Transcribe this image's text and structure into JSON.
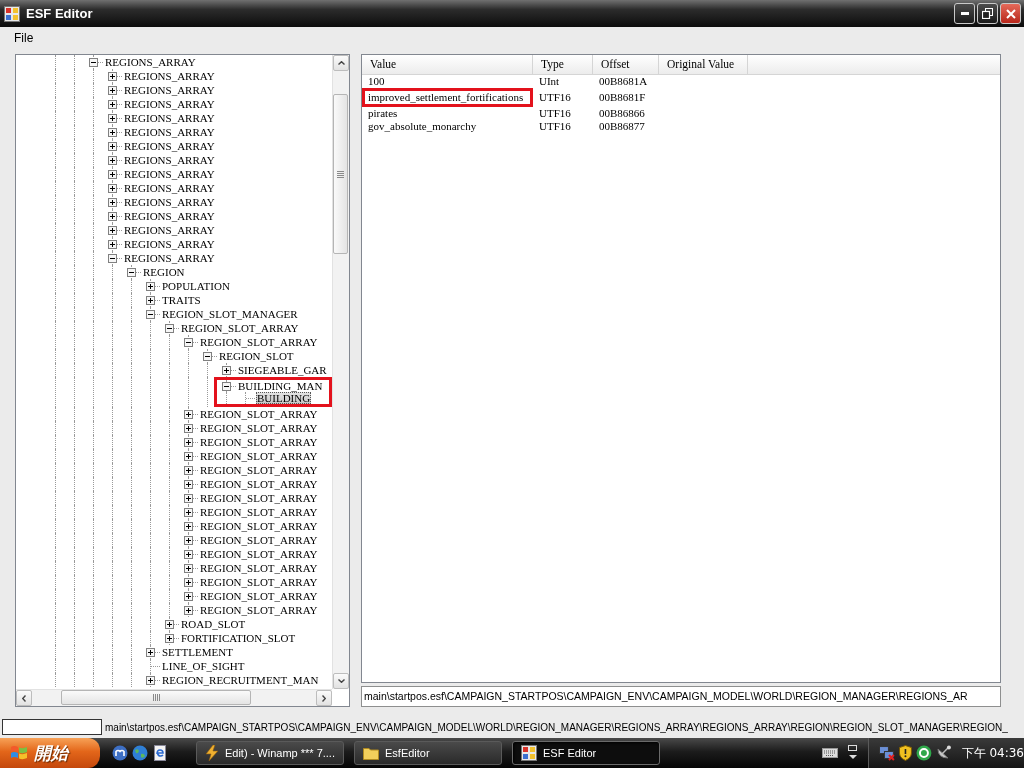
{
  "window": {
    "title": "ESF Editor"
  },
  "menu": [
    "File"
  ],
  "tree": {
    "nodes": [
      {
        "label": "REGIONS_ARRAY",
        "kind": "branch",
        "expanded": true,
        "selected": false,
        "highlighted": false,
        "children": [
          {
            "label": "REGIONS_ARRAY",
            "kind": "branch",
            "expanded": false,
            "selected": false,
            "highlighted": false
          },
          {
            "label": "REGIONS_ARRAY",
            "kind": "branch",
            "expanded": false,
            "selected": false,
            "highlighted": false
          },
          {
            "label": "REGIONS_ARRAY",
            "kind": "branch",
            "expanded": false,
            "selected": false,
            "highlighted": false
          },
          {
            "label": "REGIONS_ARRAY",
            "kind": "branch",
            "expanded": false,
            "selected": false,
            "highlighted": false
          },
          {
            "label": "REGIONS_ARRAY",
            "kind": "branch",
            "expanded": false,
            "selected": false,
            "highlighted": false
          },
          {
            "label": "REGIONS_ARRAY",
            "kind": "branch",
            "expanded": false,
            "selected": false,
            "highlighted": false
          },
          {
            "label": "REGIONS_ARRAY",
            "kind": "branch",
            "expanded": false,
            "selected": false,
            "highlighted": false
          },
          {
            "label": "REGIONS_ARRAY",
            "kind": "branch",
            "expanded": false,
            "selected": false,
            "highlighted": false
          },
          {
            "label": "REGIONS_ARRAY",
            "kind": "branch",
            "expanded": false,
            "selected": false,
            "highlighted": false
          },
          {
            "label": "REGIONS_ARRAY",
            "kind": "branch",
            "expanded": false,
            "selected": false,
            "highlighted": false
          },
          {
            "label": "REGIONS_ARRAY",
            "kind": "branch",
            "expanded": false,
            "selected": false,
            "highlighted": false
          },
          {
            "label": "REGIONS_ARRAY",
            "kind": "branch",
            "expanded": false,
            "selected": false,
            "highlighted": false
          },
          {
            "label": "REGIONS_ARRAY",
            "kind": "branch",
            "expanded": false,
            "selected": false,
            "highlighted": false
          },
          {
            "label": "REGIONS_ARRAY",
            "kind": "branch",
            "expanded": true,
            "selected": false,
            "highlighted": false,
            "children": [
              {
                "label": "REGION",
                "kind": "branch",
                "expanded": true,
                "selected": false,
                "highlighted": false,
                "children": [
                  {
                    "label": "POPULATION",
                    "kind": "branch",
                    "expanded": false,
                    "selected": false,
                    "highlighted": false
                  },
                  {
                    "label": "TRAITS",
                    "kind": "branch",
                    "expanded": false,
                    "selected": false,
                    "highlighted": false
                  },
                  {
                    "label": "REGION_SLOT_MANAGER",
                    "kind": "branch",
                    "expanded": true,
                    "selected": false,
                    "highlighted": false,
                    "children": [
                      {
                        "label": "REGION_SLOT_ARRAY",
                        "kind": "branch",
                        "expanded": true,
                        "selected": false,
                        "highlighted": false,
                        "children": [
                          {
                            "label": "REGION_SLOT_ARRAY",
                            "kind": "branch",
                            "expanded": true,
                            "selected": false,
                            "highlighted": false,
                            "children": [
                              {
                                "label": "REGION_SLOT",
                                "kind": "branch",
                                "expanded": true,
                                "selected": false,
                                "highlighted": false,
                                "children": [
                                  {
                                    "label": "SIEGEABLE_GAR",
                                    "kind": "branch",
                                    "expanded": false,
                                    "selected": false,
                                    "highlighted": false
                                  },
                                  {
                                    "label": "BUILDING_MAN",
                                    "kind": "branch",
                                    "expanded": true,
                                    "selected": false,
                                    "highlighted": true,
                                    "children": [
                                      {
                                        "label": "BUILDING",
                                        "kind": "leaf",
                                        "selected": true,
                                        "highlighted": false
                                      }
                                    ]
                                  }
                                ]
                              }
                            ]
                          },
                          {
                            "label": "REGION_SLOT_ARRAY",
                            "kind": "branch",
                            "expanded": false,
                            "selected": false,
                            "highlighted": false
                          },
                          {
                            "label": "REGION_SLOT_ARRAY",
                            "kind": "branch",
                            "expanded": false,
                            "selected": false,
                            "highlighted": false
                          },
                          {
                            "label": "REGION_SLOT_ARRAY",
                            "kind": "branch",
                            "expanded": false,
                            "selected": false,
                            "highlighted": false
                          },
                          {
                            "label": "REGION_SLOT_ARRAY",
                            "kind": "branch",
                            "expanded": false,
                            "selected": false,
                            "highlighted": false
                          },
                          {
                            "label": "REGION_SLOT_ARRAY",
                            "kind": "branch",
                            "expanded": false,
                            "selected": false,
                            "highlighted": false
                          },
                          {
                            "label": "REGION_SLOT_ARRAY",
                            "kind": "branch",
                            "expanded": false,
                            "selected": false,
                            "highlighted": false
                          },
                          {
                            "label": "REGION_SLOT_ARRAY",
                            "kind": "branch",
                            "expanded": false,
                            "selected": false,
                            "highlighted": false
                          },
                          {
                            "label": "REGION_SLOT_ARRAY",
                            "kind": "branch",
                            "expanded": false,
                            "selected": false,
                            "highlighted": false
                          },
                          {
                            "label": "REGION_SLOT_ARRAY",
                            "kind": "branch",
                            "expanded": false,
                            "selected": false,
                            "highlighted": false
                          },
                          {
                            "label": "REGION_SLOT_ARRAY",
                            "kind": "branch",
                            "expanded": false,
                            "selected": false,
                            "highlighted": false
                          },
                          {
                            "label": "REGION_SLOT_ARRAY",
                            "kind": "branch",
                            "expanded": false,
                            "selected": false,
                            "highlighted": false
                          },
                          {
                            "label": "REGION_SLOT_ARRAY",
                            "kind": "branch",
                            "expanded": false,
                            "selected": false,
                            "highlighted": false
                          },
                          {
                            "label": "REGION_SLOT_ARRAY",
                            "kind": "branch",
                            "expanded": false,
                            "selected": false,
                            "highlighted": false
                          },
                          {
                            "label": "REGION_SLOT_ARRAY",
                            "kind": "branch",
                            "expanded": false,
                            "selected": false,
                            "highlighted": false
                          },
                          {
                            "label": "REGION_SLOT_ARRAY",
                            "kind": "branch",
                            "expanded": false,
                            "selected": false,
                            "highlighted": false
                          }
                        ]
                      },
                      {
                        "label": "ROAD_SLOT",
                        "kind": "branch",
                        "expanded": false,
                        "selected": false,
                        "highlighted": false
                      },
                      {
                        "label": "FORTIFICATION_SLOT",
                        "kind": "branch",
                        "expanded": false,
                        "selected": false,
                        "highlighted": false
                      }
                    ]
                  },
                  {
                    "label": "SETTLEMENT",
                    "kind": "branch",
                    "expanded": false,
                    "selected": false,
                    "highlighted": false
                  },
                  {
                    "label": "LINE_OF_SIGHT",
                    "kind": "leaf",
                    "selected": false,
                    "highlighted": false
                  },
                  {
                    "label": "REGION_RECRUITMENT_MAN",
                    "kind": "branch",
                    "expanded": false,
                    "selected": false,
                    "highlighted": false
                  }
                ]
              }
            ]
          }
        ]
      }
    ]
  },
  "table": {
    "columns": [
      "Value",
      "Type",
      "Offset",
      "Original Value"
    ],
    "rows": [
      {
        "value": "100",
        "type": "UInt",
        "offset": "00B8681A",
        "highlighted": false
      },
      {
        "value": "improved_settlement_fortifications",
        "type": "UTF16",
        "offset": "00B8681F",
        "highlighted": true
      },
      {
        "value": "pirates",
        "type": "UTF16",
        "offset": "00B86866",
        "highlighted": false
      },
      {
        "value": "gov_absolute_monarchy",
        "type": "UTF16",
        "offset": "00B86877",
        "highlighted": false
      }
    ]
  },
  "path_field": {
    "value": "main\\startpos.esf\\CAMPAIGN_STARTPOS\\CAMPAIGN_ENV\\CAMPAIGN_MODEL\\WORLD\\REGION_MANAGER\\REGIONS_AR"
  },
  "status_bar": {
    "text": "main\\startpos.esf\\CAMPAIGN_STARTPOS\\CAMPAIGN_ENV\\CAMPAIGN_MODEL\\WORLD\\REGION_MANAGER\\REGIONS_ARRAY\\REGIONS_ARRAY\\REGION\\REGION_SLOT_MANAGER\\REGION_"
  },
  "taskbar": {
    "start": "開始",
    "tasks": [
      {
        "label": "Edit) - Winamp *** 7....",
        "kind": "player",
        "selected": false
      },
      {
        "label": "EsfEditor",
        "kind": "folder",
        "selected": false
      },
      {
        "label": "ESF Editor",
        "kind": "app",
        "selected": true
      }
    ],
    "clock": "下午 04:36"
  }
}
